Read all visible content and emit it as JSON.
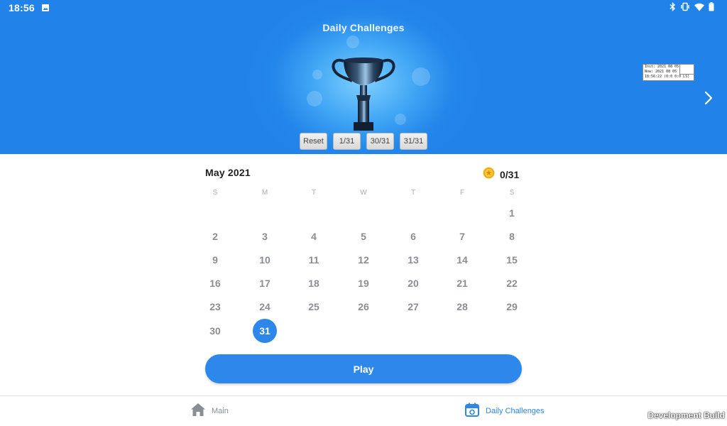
{
  "status_bar": {
    "time": "18:56",
    "icons": [
      "gallery-icon",
      "bluetooth-icon",
      "vibrate-icon",
      "wifi-icon",
      "battery-icon"
    ]
  },
  "header": {
    "title": "Daily Challenges",
    "debug_info": [
      "Inst: 2021 08 05",
      "Now: 2021 08 05",
      "18:56:22 (0:0 0:0 LS)"
    ],
    "debug_buttons": [
      "Reset",
      "1/31",
      "30/31",
      "31/31"
    ]
  },
  "calendar": {
    "month_label": "May 2021",
    "progress": "0/31",
    "weekdays": [
      "S",
      "M",
      "T",
      "W",
      "T",
      "F",
      "S"
    ],
    "days": [
      "1",
      "2",
      "3",
      "4",
      "5",
      "6",
      "7",
      "8",
      "9",
      "10",
      "11",
      "12",
      "13",
      "14",
      "15",
      "16",
      "17",
      "18",
      "19",
      "20",
      "21",
      "22",
      "23",
      "24",
      "25",
      "26",
      "27",
      "28",
      "29",
      "30",
      "31"
    ],
    "selected_day": "31"
  },
  "play_label": "Play",
  "bottom_nav": {
    "main_label": "Main",
    "daily_label": "Daily Challenges"
  },
  "dev_build_label": "Development Build",
  "colors": {
    "accent": "#2d86ea",
    "header_bg": "#2182e9",
    "coin": "#f5b820"
  }
}
